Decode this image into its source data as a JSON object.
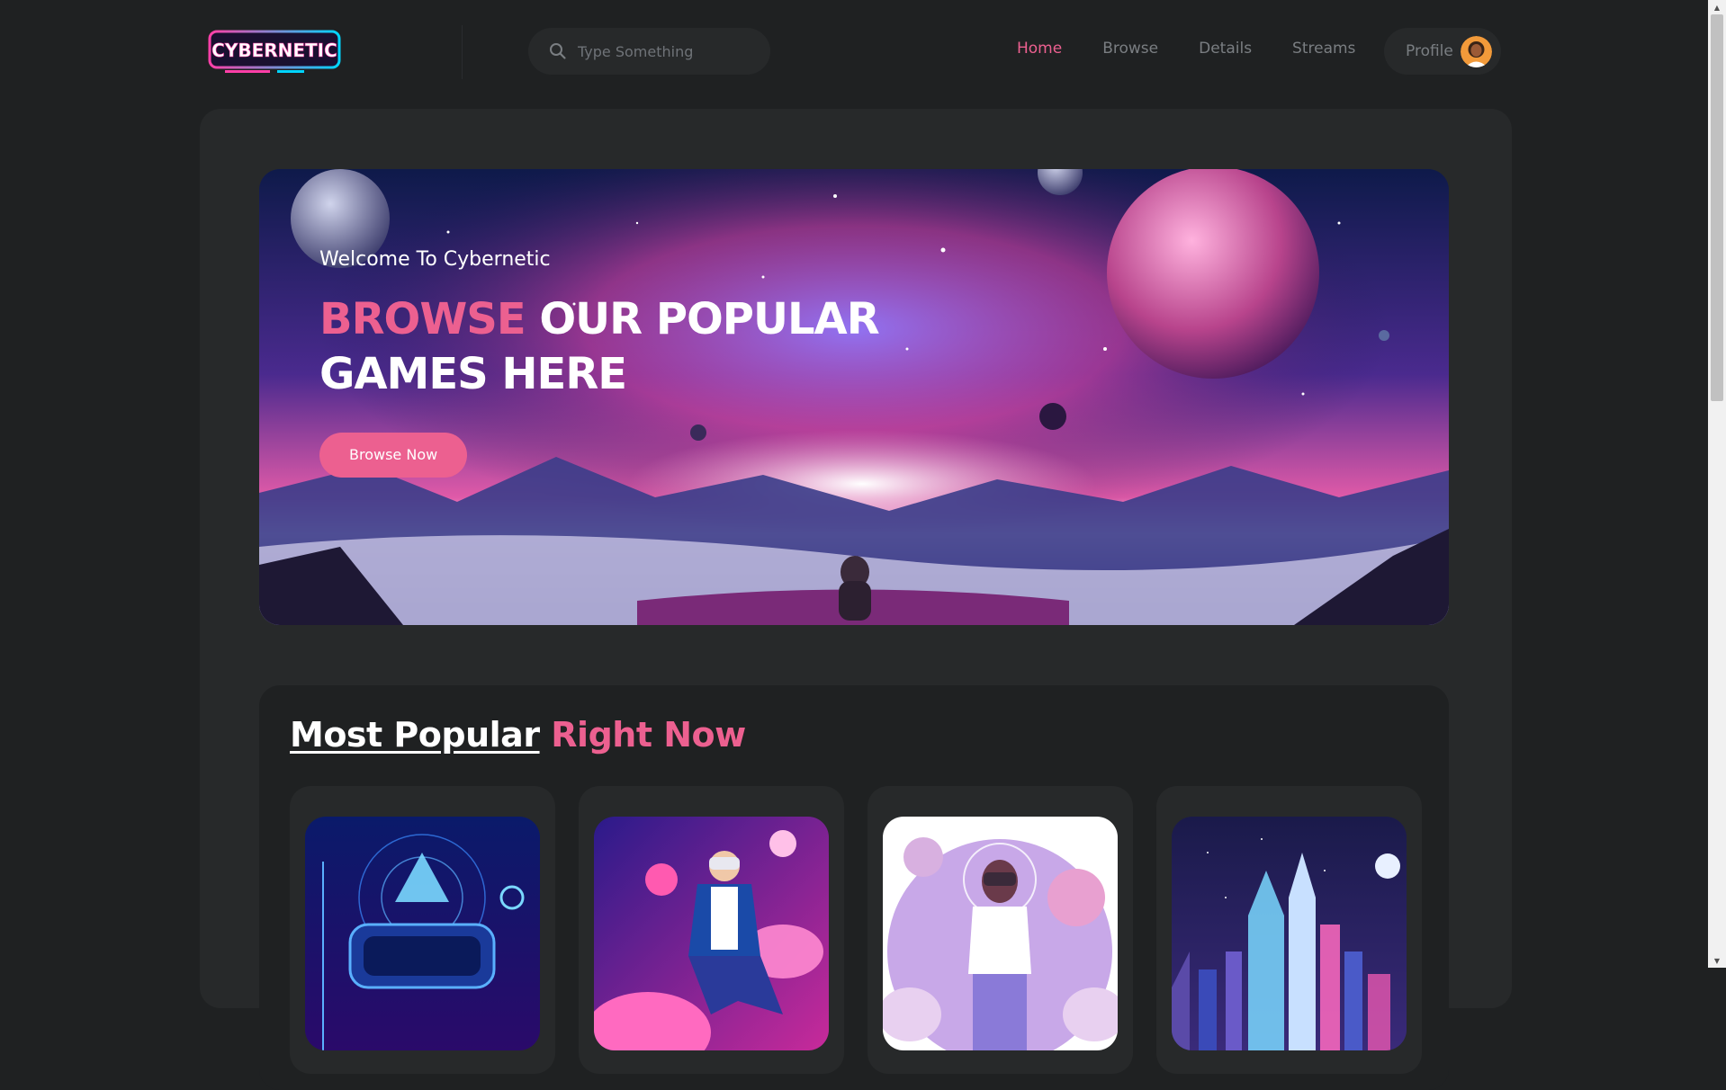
{
  "brand": {
    "logo_text": "CYBERNETIC"
  },
  "search": {
    "placeholder": "Type Something"
  },
  "nav": {
    "items": [
      {
        "label": "Home",
        "active": true
      },
      {
        "label": "Browse",
        "active": false
      },
      {
        "label": "Details",
        "active": false
      },
      {
        "label": "Streams",
        "active": false
      }
    ],
    "profile_label": "Profile"
  },
  "banner": {
    "welcome": "Welcome To Cybernetic",
    "headline_accent": "BROWSE",
    "headline_rest_line1": " OUR POPULAR",
    "headline_line2": "GAMES HERE",
    "button_label": "Browse Now"
  },
  "popular": {
    "title_part1": "Most Popular",
    "title_part2": "Right Now",
    "cards": [
      {
        "icon": "vr-headset-art"
      },
      {
        "icon": "vr-astronaut-art"
      },
      {
        "icon": "vr-girl-space-art"
      },
      {
        "icon": "neon-city-art"
      }
    ]
  },
  "colors": {
    "accent": "#ec6090",
    "background": "#1f2122",
    "panel": "#27292a",
    "muted_text": "#7a7e82"
  }
}
